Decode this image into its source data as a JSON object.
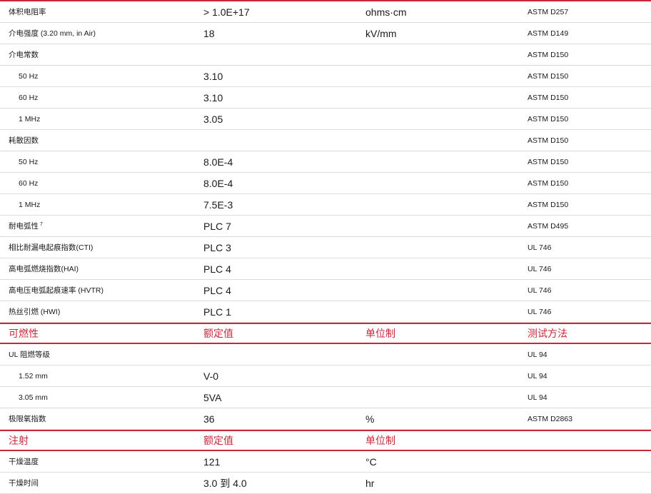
{
  "accent_color": "#c8283a",
  "rows": [
    {
      "type": "data",
      "property": "体积电阻率",
      "value": "> 1.0E+17",
      "unit": "ohms·cm",
      "method": "ASTM D257"
    },
    {
      "type": "data",
      "property": "介电强度 (3.20 mm, in Air)",
      "value": "18",
      "unit": "kV/mm",
      "method": "ASTM D149"
    },
    {
      "type": "data",
      "property": "介电常数",
      "value": "",
      "unit": "",
      "method": "ASTM D150"
    },
    {
      "type": "data",
      "indent": true,
      "property": "50 Hz",
      "value": "3.10",
      "unit": "",
      "method": "ASTM D150"
    },
    {
      "type": "data",
      "indent": true,
      "property": "60 Hz",
      "value": "3.10",
      "unit": "",
      "method": "ASTM D150"
    },
    {
      "type": "data",
      "indent": true,
      "property": "1 MHz",
      "value": "3.05",
      "unit": "",
      "method": "ASTM D150"
    },
    {
      "type": "data",
      "property": "耗散因数",
      "value": "",
      "unit": "",
      "method": "ASTM D150"
    },
    {
      "type": "data",
      "indent": true,
      "property": "50 Hz",
      "value": "8.0E-4",
      "unit": "",
      "method": "ASTM D150"
    },
    {
      "type": "data",
      "indent": true,
      "property": "60 Hz",
      "value": "8.0E-4",
      "unit": "",
      "method": "ASTM D150"
    },
    {
      "type": "data",
      "indent": true,
      "property": "1 MHz",
      "value": "7.5E-3",
      "unit": "",
      "method": "ASTM D150"
    },
    {
      "type": "data",
      "property": "耐电弧性",
      "sup": "7",
      "value": "PLC 7",
      "unit": "",
      "method": "ASTM D495"
    },
    {
      "type": "data",
      "property": "相比耐漏电起痕指数(CTI)",
      "value": "PLC 3",
      "unit": "",
      "method": "UL 746"
    },
    {
      "type": "data",
      "property": "高电弧燃烧指数(HAI)",
      "value": "PLC 4",
      "unit": "",
      "method": "UL 746"
    },
    {
      "type": "data",
      "property": "高电压电弧起痕速率 (HVTR)",
      "value": "PLC 4",
      "unit": "",
      "method": "UL 746"
    },
    {
      "type": "data",
      "property": "热丝引燃 (HWI)",
      "value": "PLC 1",
      "unit": "",
      "method": "UL 746"
    },
    {
      "type": "header",
      "property": "可燃性",
      "value": "额定值",
      "unit": "单位制",
      "method": "测试方法"
    },
    {
      "type": "data",
      "property": "UL 阻燃等级",
      "value": "",
      "unit": "",
      "method": "UL 94"
    },
    {
      "type": "data",
      "indent": true,
      "property": "1.52 mm",
      "value": "V-0",
      "unit": "",
      "method": "UL 94"
    },
    {
      "type": "data",
      "indent": true,
      "property": "3.05 mm",
      "value": "5VA",
      "unit": "",
      "method": "UL 94"
    },
    {
      "type": "data",
      "property": "极限氧指数",
      "value": "36",
      "unit": "%",
      "method": "ASTM D2863"
    },
    {
      "type": "header",
      "property": "注射",
      "value": "额定值",
      "unit": "单位制",
      "method": ""
    },
    {
      "type": "data",
      "property": "干燥温度",
      "value": "121",
      "unit": "°C",
      "method": ""
    },
    {
      "type": "data",
      "property": "干燥时间",
      "value": "3.0 到 4.0",
      "unit": "hr",
      "method": ""
    }
  ]
}
